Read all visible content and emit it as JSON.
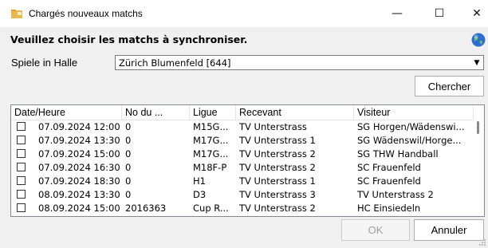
{
  "window": {
    "title": "Chargés nouveaux matchs",
    "minimize": "—",
    "maximize": "☐",
    "close": "✕"
  },
  "heading": "Veuillez choisir les matchs à synchroniser.",
  "hall": {
    "label": "Spiele in Halle",
    "selected": "Zürich Blumenfeld [644]",
    "arrow": "▼"
  },
  "search_label": "Chercher",
  "table": {
    "columns": [
      "Date/Heure",
      "No du ...",
      "Ligue",
      "Recevant",
      "Visiteur"
    ],
    "rows": [
      {
        "date": "07.09.2024 12:00",
        "no": "0",
        "ligue": "M15G...",
        "recevant": "TV Unterstrass",
        "visiteur": "SG Horgen/Wädenswi..."
      },
      {
        "date": "07.09.2024 13:30",
        "no": "0",
        "ligue": "M17G...",
        "recevant": "TV Unterstrass 1",
        "visiteur": "SG Wädenswil/Horge..."
      },
      {
        "date": "07.09.2024 15:00",
        "no": "0",
        "ligue": "M17G...",
        "recevant": "TV Unterstrass 2",
        "visiteur": "SG THW Handball"
      },
      {
        "date": "07.09.2024 16:30",
        "no": "0",
        "ligue": "M18F-P",
        "recevant": "TV Unterstrass 2",
        "visiteur": "SC Frauenfeld"
      },
      {
        "date": "07.09.2024 18:30",
        "no": "0",
        "ligue": "H1",
        "recevant": "TV Unterstrass 1",
        "visiteur": "SC Frauenfeld"
      },
      {
        "date": "08.09.2024 13:30",
        "no": "0",
        "ligue": "D3",
        "recevant": "TV Unterstrass 3",
        "visiteur": "TV Unterstrass 2"
      },
      {
        "date": "08.09.2024 15:00",
        "no": "2016363",
        "ligue": "Cup R...",
        "recevant": "TV Unterstrass 2",
        "visiteur": "HC Einsiedeln"
      }
    ]
  },
  "ok_label": "OK",
  "cancel_label": "Annuler",
  "colors": {
    "icon_folder": "#e8b84a",
    "globe": "#2d6fd1"
  }
}
